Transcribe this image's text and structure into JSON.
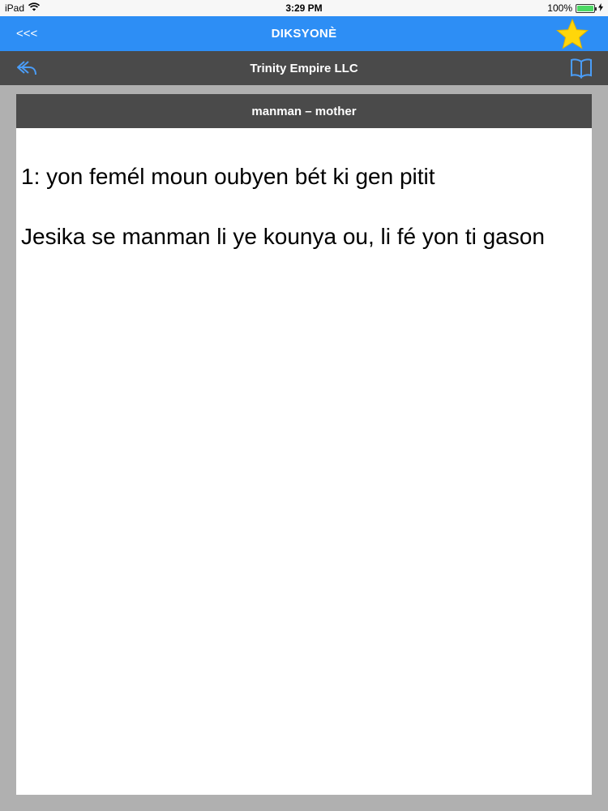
{
  "status": {
    "device": "iPad",
    "time": "3:29 PM",
    "battery": "100%"
  },
  "nav": {
    "back_label": "<<<",
    "title": "DIKSYONÈ",
    "star_color": "#ffd60a"
  },
  "sub": {
    "title": "Trinity Empire LLC"
  },
  "entry": {
    "header": "manman – mother",
    "definition": "1: yon femél moun oubyen bét ki gen pitit",
    "example": "Jesika se manman li ye kounya ou, li fé yon ti gason"
  }
}
